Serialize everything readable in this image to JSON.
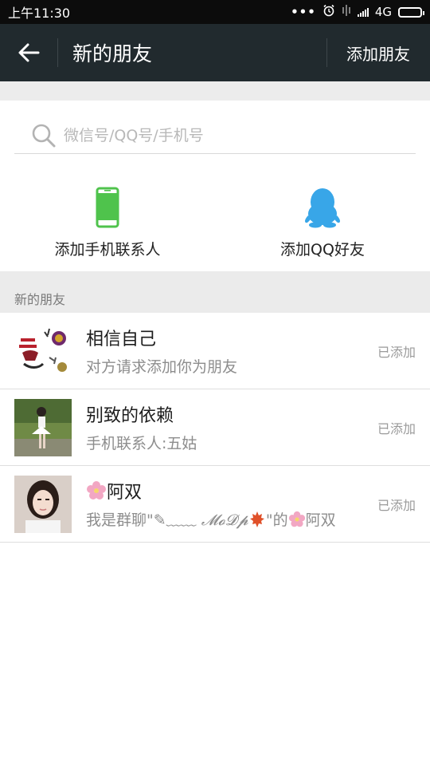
{
  "status_bar": {
    "time": "上午11:30",
    "dots": "•••",
    "network": "4G",
    "icons": [
      "alarm-icon",
      "vibrate-icon",
      "signal-icon",
      "battery-icon"
    ]
  },
  "title_bar": {
    "title": "新的朋友",
    "action_label": "添加朋友",
    "background": "#212a2e"
  },
  "search": {
    "placeholder": "微信号/QQ号/手机号",
    "value": ""
  },
  "quick_add": [
    {
      "label": "添加手机联系人",
      "icon": "phone-icon",
      "color": "#4fc34c"
    },
    {
      "label": "添加QQ好友",
      "icon": "qq-penguin-icon",
      "color": "#38a6e8"
    }
  ],
  "section_title": "新的朋友",
  "friends": [
    {
      "name": "相信自己",
      "message": "对方请求添加你为朋友",
      "status": "已添加"
    },
    {
      "name": "别致的依赖",
      "message": "手机联系人:五姑",
      "status": "已添加"
    },
    {
      "name_text": "阿双",
      "message_prefix": "我是群聊\"",
      "message_group": "✎﹏﹏ 𝓜𝓸𝓓𝓹",
      "message_mid": "\"的",
      "message_suffix": "阿双",
      "status": "已添加"
    }
  ],
  "colors": {
    "status_bar": "#0c0c0c",
    "page_band": "#ececec",
    "muted_text": "#8d8d8d"
  }
}
